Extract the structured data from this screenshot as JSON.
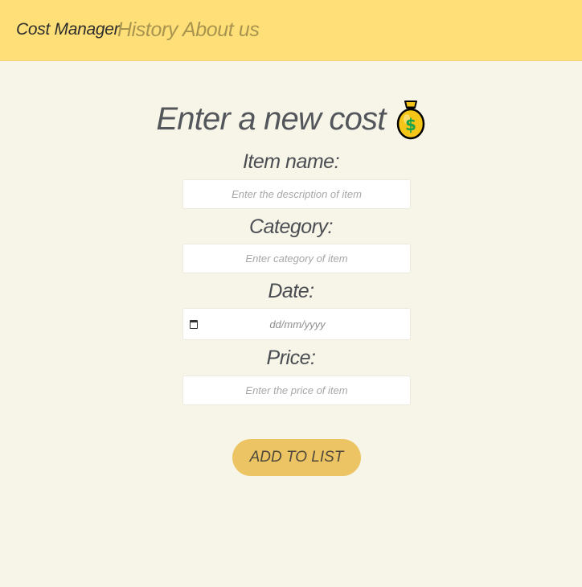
{
  "nav": {
    "brand": "Cost Manager",
    "links": [
      {
        "label": "History"
      },
      {
        "label": "About us"
      }
    ],
    "colors": {
      "bar": "#ffdf78",
      "link": "#a8944e"
    }
  },
  "form": {
    "title": "Enter a new cost",
    "title_icon": "money-bag-icon",
    "fields": {
      "item_name": {
        "label": "Item name:",
        "placeholder": "Enter the description of item"
      },
      "category": {
        "label": "Category:",
        "placeholder": "Enter category of item"
      },
      "date": {
        "label": "Date:",
        "placeholder": "dd/mm/yyyy",
        "icon": "calendar-icon"
      },
      "price": {
        "label": "Price:",
        "placeholder": "Enter the price of item"
      }
    },
    "submit_label": "ADD TO LIST",
    "colors": {
      "background": "#f7f5e8",
      "button": "#ecc463"
    }
  }
}
